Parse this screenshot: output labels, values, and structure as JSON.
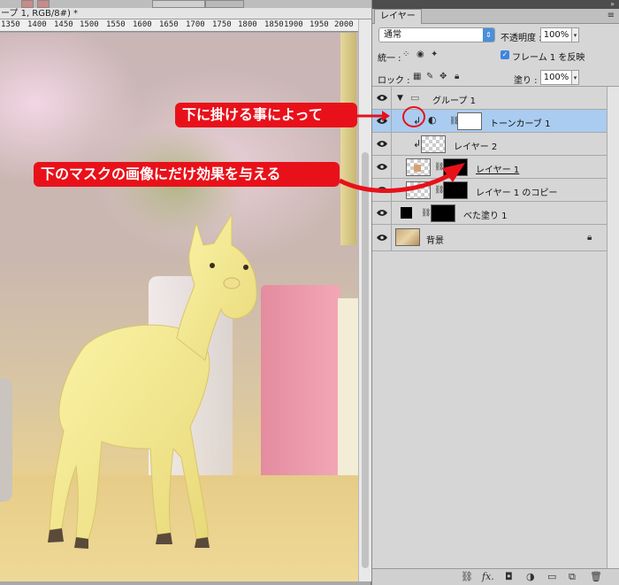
{
  "document": {
    "title": "ープ 1, RGB/8#) *",
    "ruler_labels": [
      "1350",
      "1400",
      "1450",
      "1500",
      "1550",
      "1600",
      "1650",
      "1700",
      "1750",
      "1800",
      "1850",
      "1900",
      "1950",
      "2000"
    ]
  },
  "layers_panel": {
    "tab_label": "レイヤー",
    "panel_menu_icon": "≡",
    "blend_mode": "通常",
    "opacity_label": "不透明度 :",
    "opacity_value": "100%",
    "unify_label": "統一 :",
    "frame_checkbox_label": "フレーム 1 を反映",
    "lock_label": "ロック :",
    "fill_label": "塗り :",
    "fill_value": "100%",
    "layers": [
      {
        "name": "グループ 1",
        "type": "group"
      },
      {
        "name": "トーンカーブ 1",
        "type": "adjustment",
        "selected": true,
        "clipped": true
      },
      {
        "name": "レイヤー 2",
        "type": "pixel",
        "clipped": true
      },
      {
        "name": "レイヤー 1",
        "type": "pixel-masked",
        "underline": true
      },
      {
        "name": "レイヤー 1 のコピー",
        "type": "pixel-masked"
      },
      {
        "name": "べた塗り 1",
        "type": "fill"
      },
      {
        "name": "背景",
        "type": "background",
        "locked": true
      }
    ],
    "bottom_icons": [
      "link-icon",
      "fx-icon",
      "mask-icon",
      "adjustment-icon",
      "folder-icon",
      "new-layer-icon",
      "trash-icon"
    ]
  },
  "annotations": {
    "callout_1": "下に掛ける事によって",
    "callout_2": "下のマスクの画像にだけ効果を与える"
  },
  "colors": {
    "annotation_red": "#e8111a",
    "selection_blue": "#aaccf0",
    "accent_blue": "#4a8fdd"
  }
}
